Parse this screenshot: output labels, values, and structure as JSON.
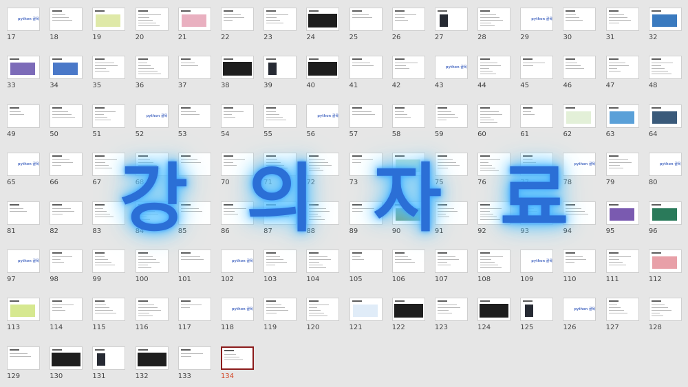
{
  "slides": [
    "17",
    "18",
    "19",
    "20",
    "21",
    "22",
    "23",
    "24",
    "25",
    "26",
    "27",
    "28",
    "29",
    "30",
    "31",
    "32",
    "33",
    "34",
    "35",
    "36",
    "37",
    "38",
    "39",
    "40",
    "41",
    "42",
    "43",
    "44",
    "45",
    "46",
    "47",
    "48",
    "49",
    "50",
    "51",
    "52",
    "53",
    "54",
    "55",
    "56",
    "57",
    "58",
    "59",
    "60",
    "61",
    "62",
    "63",
    "64",
    "65",
    "66",
    "67",
    "68",
    "69",
    "70",
    "71",
    "72",
    "73",
    "74",
    "75",
    "76",
    "77",
    "78",
    "79",
    "80",
    "81",
    "82",
    "83",
    "84",
    "85",
    "86",
    "87",
    "88",
    "89",
    "90",
    "91",
    "92",
    "93",
    "94",
    "95",
    "96",
    "97",
    "98",
    "99",
    "100",
    "101",
    "102",
    "103",
    "104",
    "105",
    "106",
    "107",
    "108",
    "109",
    "110",
    "111",
    "112",
    "113",
    "114",
    "115",
    "116",
    "117",
    "118",
    "119",
    "120",
    "121",
    "122",
    "123",
    "124",
    "125",
    "126",
    "127",
    "128",
    "129",
    "130",
    "131",
    "132",
    "133",
    "134"
  ],
  "selected_slide": "134",
  "logo_text": "python 골목",
  "overlay": {
    "text": "강의자료",
    "color": "#2b6fd6",
    "glow_color": "#46b4ff"
  },
  "colors": {
    "background": "#e6e6e6",
    "selected_border": "#8b1a1a",
    "selected_number": "#d24726"
  }
}
